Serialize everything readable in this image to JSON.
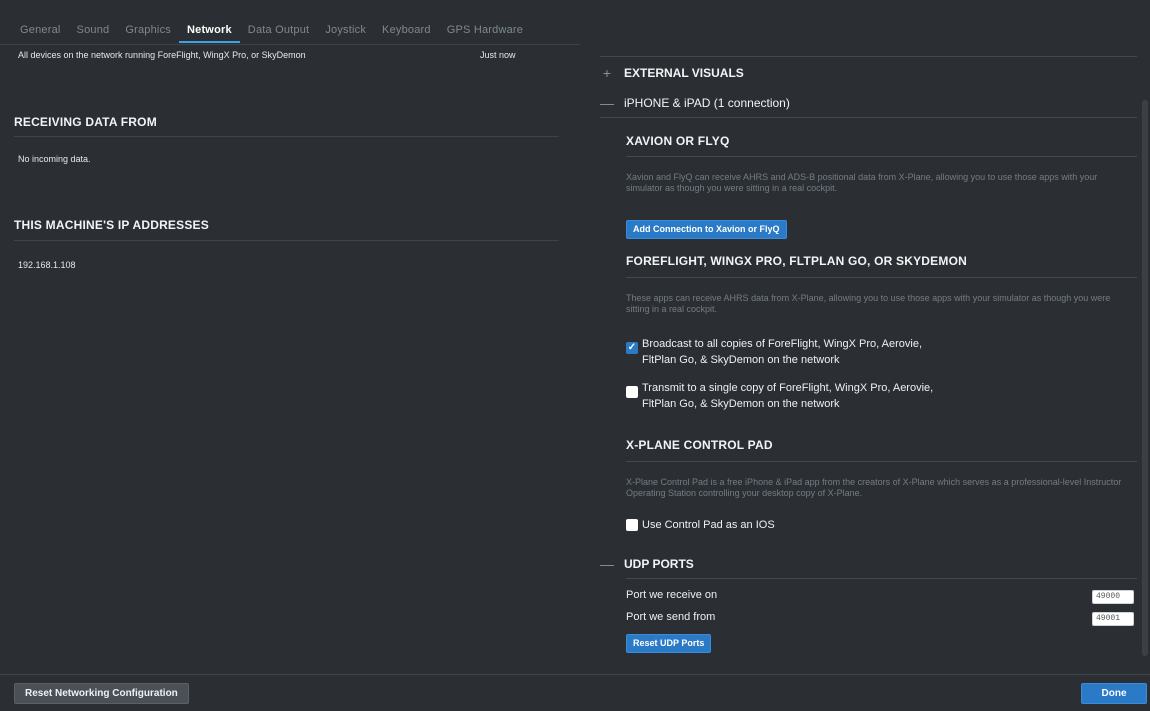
{
  "tabs": [
    "General",
    "Sound",
    "Graphics",
    "Network",
    "Data Output",
    "Joystick",
    "Keyboard",
    "GPS Hardware"
  ],
  "active_tab": "Network",
  "left": {
    "devices_row": {
      "text": "All devices on the network running ForeFlight, WingX Pro, or SkyDemon",
      "time": "Just now"
    },
    "receiving": {
      "title": "RECEIVING DATA FROM",
      "text": "No incoming data."
    },
    "ip": {
      "title": "THIS MACHINE'S IP ADDRESSES",
      "text": "192.168.1.108"
    }
  },
  "right": {
    "external_visuals": {
      "sign": "+",
      "title": "EXTERNAL VISUALS"
    },
    "iphone_ipad": {
      "sign": "—",
      "title": "iPHONE & iPAD (1 connection)"
    },
    "xavion": {
      "title": "XAVION OR FLYQ",
      "desc": "Xavion and FlyQ can receive AHRS and ADS-B positional data from X-Plane, allowing you to use those apps with your simulator as though you were sitting in a real cockpit.",
      "button": "Add Connection to Xavion or FlyQ"
    },
    "foreflight": {
      "title": "FOREFLIGHT, WINGX PRO, FLTPLAN GO, OR SKYDEMON",
      "desc": "These apps can receive AHRS data from X-Plane, allowing you to use those apps with your simulator as though you were sitting in a real cockpit.",
      "broadcast_line1": "Broadcast to all copies of ForeFlight, WingX Pro, Aerovie,",
      "broadcast_line2": "FltPlan Go, & SkyDemon on the network",
      "broadcast_checked": true,
      "transmit_line1": "Transmit to a single copy of ForeFlight, WingX Pro, Aerovie,",
      "transmit_line2": "FltPlan Go, & SkyDemon on the network",
      "transmit_checked": false
    },
    "control_pad": {
      "title": "X-PLANE CONTROL PAD",
      "desc": "X-Plane Control Pad is a free iPhone & iPad app from the creators of X-Plane which serves as a professional-level Instructor Operating Station controlling your desktop copy of X-Plane.",
      "checkbox_label": "Use Control Pad as an IOS",
      "checked": false
    },
    "udp": {
      "sign": "—",
      "title": "UDP PORTS",
      "receive_label": "Port we receive on",
      "receive_value": "49000",
      "send_label": "Port we send from",
      "send_value": "49001",
      "reset_button": "Reset UDP Ports"
    }
  },
  "footer": {
    "reset_button": "Reset Networking Configuration",
    "done_button": "Done"
  },
  "colors": {
    "accent": "#2a7ac7",
    "background": "#2b2f33",
    "active_tab_underline": "#3aa3e6"
  }
}
